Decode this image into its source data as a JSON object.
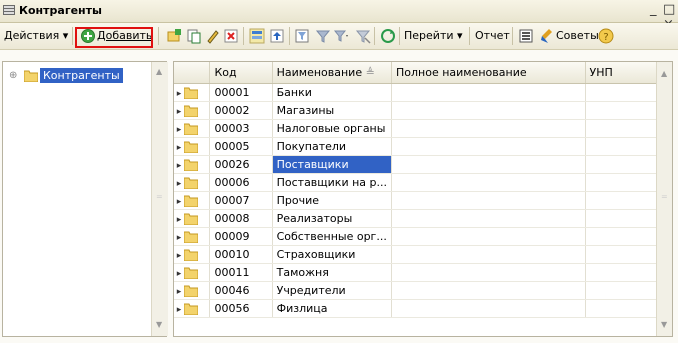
{
  "window": {
    "title": "Контрагенты"
  },
  "toolbar": {
    "actions_label": "Действия ▾",
    "add_label": "Добавить",
    "goto_label": "Перейти ▾",
    "report_label": "Отчет",
    "tips_label": "Советы"
  },
  "tree": {
    "root_label": "Контрагенты"
  },
  "table": {
    "headers": {
      "code": "Код",
      "name": "Наименование",
      "fullname": "Полное наименование",
      "unp": "УНП"
    },
    "rows": [
      {
        "code": "00001",
        "name": "Банки"
      },
      {
        "code": "00002",
        "name": "Магазины"
      },
      {
        "code": "00003",
        "name": "Налоговые органы"
      },
      {
        "code": "00005",
        "name": "Покупатели"
      },
      {
        "code": "00026",
        "name": "Поставщики"
      },
      {
        "code": "00006",
        "name": "Поставщики на р..."
      },
      {
        "code": "00007",
        "name": "Прочие"
      },
      {
        "code": "00008",
        "name": "Реализаторы"
      },
      {
        "code": "00009",
        "name": "Собственные орг..."
      },
      {
        "code": "00010",
        "name": "Страховщики"
      },
      {
        "code": "00011",
        "name": "Таможня"
      },
      {
        "code": "00046",
        "name": "Учредители"
      },
      {
        "code": "00056",
        "name": "Физлица"
      }
    ],
    "selected_index": 4
  },
  "colors": {
    "selection": "#3162c5",
    "highlight_box": "#e01010"
  }
}
